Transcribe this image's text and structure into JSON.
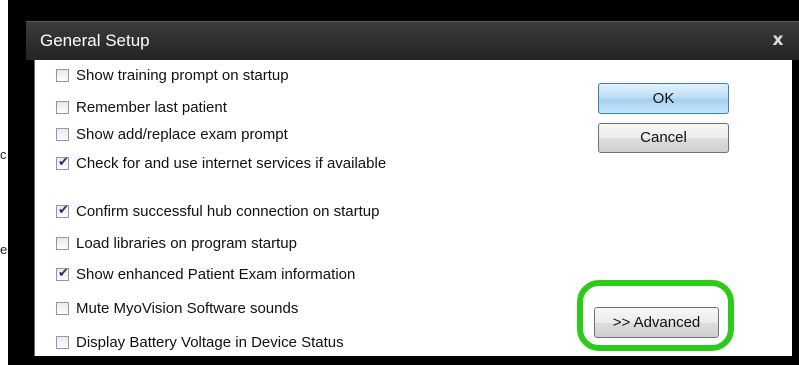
{
  "background": {
    "fragment_1": "c",
    "fragment_2": "e"
  },
  "dialog": {
    "title": "General Setup",
    "close_glyph": "x",
    "options": [
      {
        "label": "Show training prompt on startup",
        "checked": false
      },
      {
        "label": "Remember last patient",
        "checked": false
      },
      {
        "label": "Show add/replace exam prompt",
        "checked": false
      },
      {
        "label": "Check for and use internet services if available",
        "checked": true
      },
      {
        "label": "Confirm successful hub connection on startup",
        "checked": true
      },
      {
        "label": "Load libraries on program startup",
        "checked": false
      },
      {
        "label": "Show enhanced Patient Exam information",
        "checked": true
      },
      {
        "label": "Mute MyoVision Software sounds",
        "checked": false
      },
      {
        "label": "Display Battery Voltage in Device Status",
        "checked": false
      }
    ],
    "buttons": {
      "ok": "OK",
      "cancel": "Cancel",
      "advanced": ">> Advanced"
    },
    "check_glyph": "✔"
  },
  "colors": {
    "highlight": "#2ccb17",
    "ok_button": "#b8dcf6",
    "titlebar": "#2f2f2f"
  }
}
